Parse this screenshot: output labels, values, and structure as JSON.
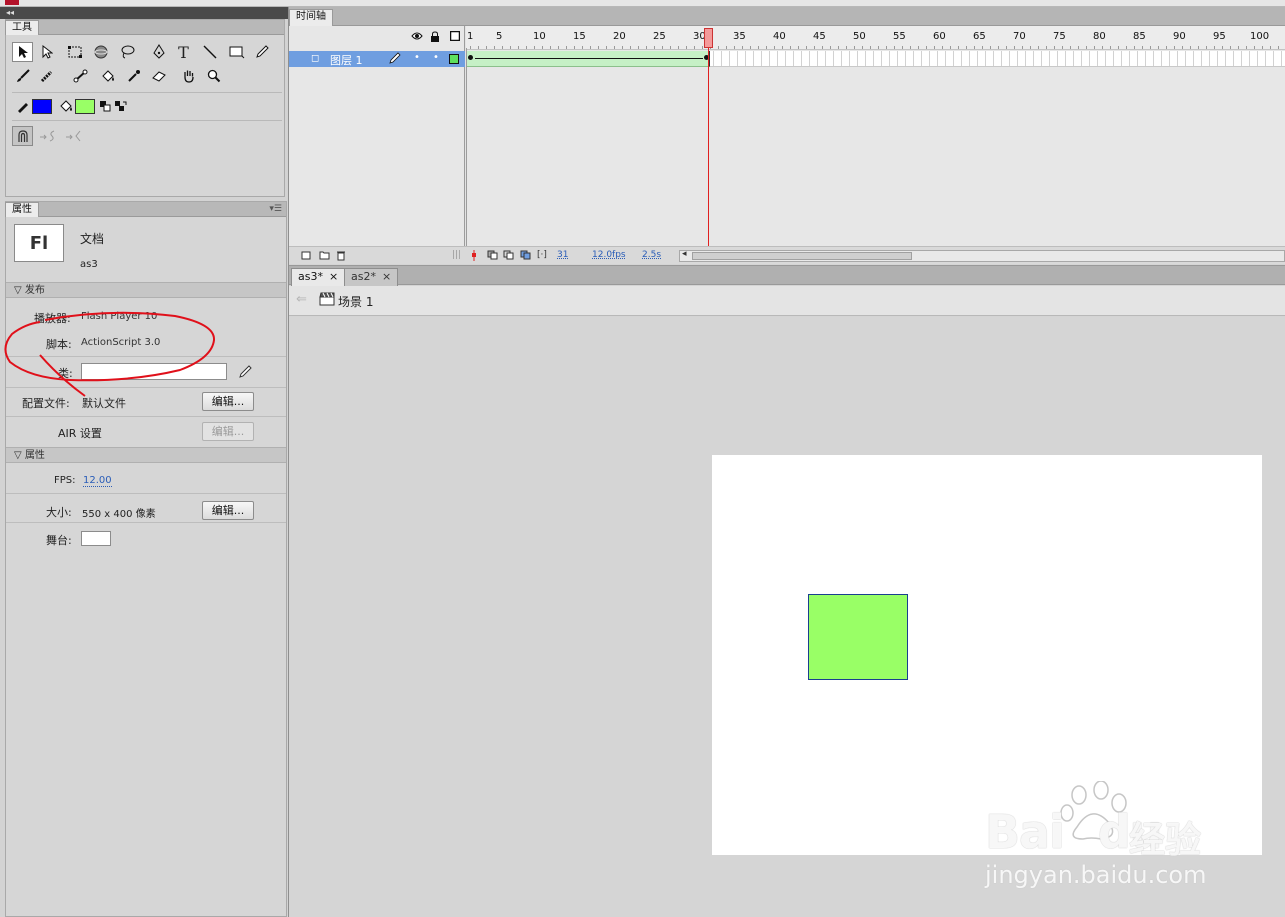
{
  "tools_panel": {
    "tab_label": "工具"
  },
  "properties_panel": {
    "tab_label": "属性",
    "doc_icon_text": "Fl",
    "doc_type": "文档",
    "doc_name": "as3",
    "publish_section": "发布",
    "player_label": "播放器:",
    "player_value": "Flash Player 10",
    "script_label": "脚本:",
    "script_value": "ActionScript 3.0",
    "class_label": "类:",
    "class_value": "",
    "profile_label": "配置文件:",
    "profile_value": "默认文件",
    "edit_label": "编辑...",
    "air_label": "AIR 设置",
    "props_section": "属性",
    "fps_label": "FPS:",
    "fps_value": "12.00",
    "size_label": "大小:",
    "size_value": "550 x 400 像素",
    "stage_label": "舞台:",
    "stage_color": "#ffffff"
  },
  "timeline": {
    "tab_label": "时间轴",
    "ruler_numbers": [
      "1",
      "5",
      "10",
      "15",
      "20",
      "25",
      "30",
      "35",
      "40",
      "45",
      "50",
      "55",
      "60",
      "65",
      "70",
      "75",
      "80",
      "85",
      "90",
      "95",
      "100"
    ],
    "layer_name": "图层 1",
    "current_frame": 31,
    "status_frame": "31",
    "status_fps": "12.0fps",
    "status_time": "2.5s"
  },
  "document_tabs": [
    {
      "label": "as3*",
      "close": "×",
      "active": true
    },
    {
      "label": "as2*",
      "close": "×",
      "active": false
    }
  ],
  "scene_bar": {
    "back_arrow": "⇐",
    "scene_label": "场景 1"
  },
  "stage_content": {
    "rect_fill": "#99ff66",
    "rect_stroke": "#1a3f8f"
  },
  "colors": {
    "stroke_swatch": "#0000ff",
    "fill_swatch": "#99ff66",
    "annotation": "#e0101a"
  },
  "watermark": {
    "brand": "Bai",
    "brand2": "du",
    "cn": "经验",
    "url": "jingyan.baidu.com"
  }
}
